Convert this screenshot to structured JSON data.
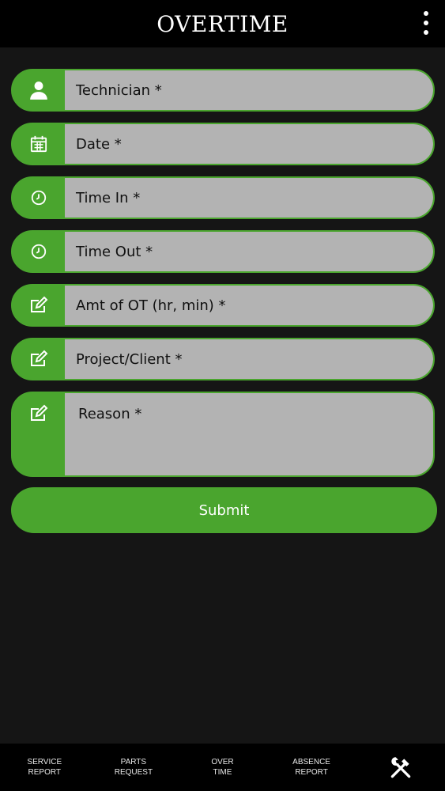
{
  "header": {
    "title": "OVERTIME",
    "menu_icon": "more-vertical-icon"
  },
  "form": {
    "fields": [
      {
        "placeholder": "Technician *",
        "icon": "person-icon"
      },
      {
        "placeholder": "Date *",
        "icon": "calendar-icon"
      },
      {
        "placeholder": "Time In *",
        "icon": "clock-icon"
      },
      {
        "placeholder": "Time Out *",
        "icon": "clock-icon"
      },
      {
        "placeholder": "Amt of OT (hr, min) *",
        "icon": "edit-icon"
      },
      {
        "placeholder": "Project/Client *",
        "icon": "edit-icon"
      },
      {
        "placeholder": "Reason *",
        "icon": "edit-icon"
      }
    ],
    "submit_label": "Submit"
  },
  "bottom_nav": {
    "items": [
      {
        "label": "SERVICE\nREPORT"
      },
      {
        "label": "PARTS\nREQUEST"
      },
      {
        "label": "OVER\nTIME"
      },
      {
        "label": "ABSENCE\nREPORT"
      },
      {
        "icon": "tools-icon"
      }
    ]
  },
  "colors": {
    "accent": "#4aa52e",
    "background": "#151515",
    "bar": "#000000",
    "field": "#b3b3b3"
  }
}
